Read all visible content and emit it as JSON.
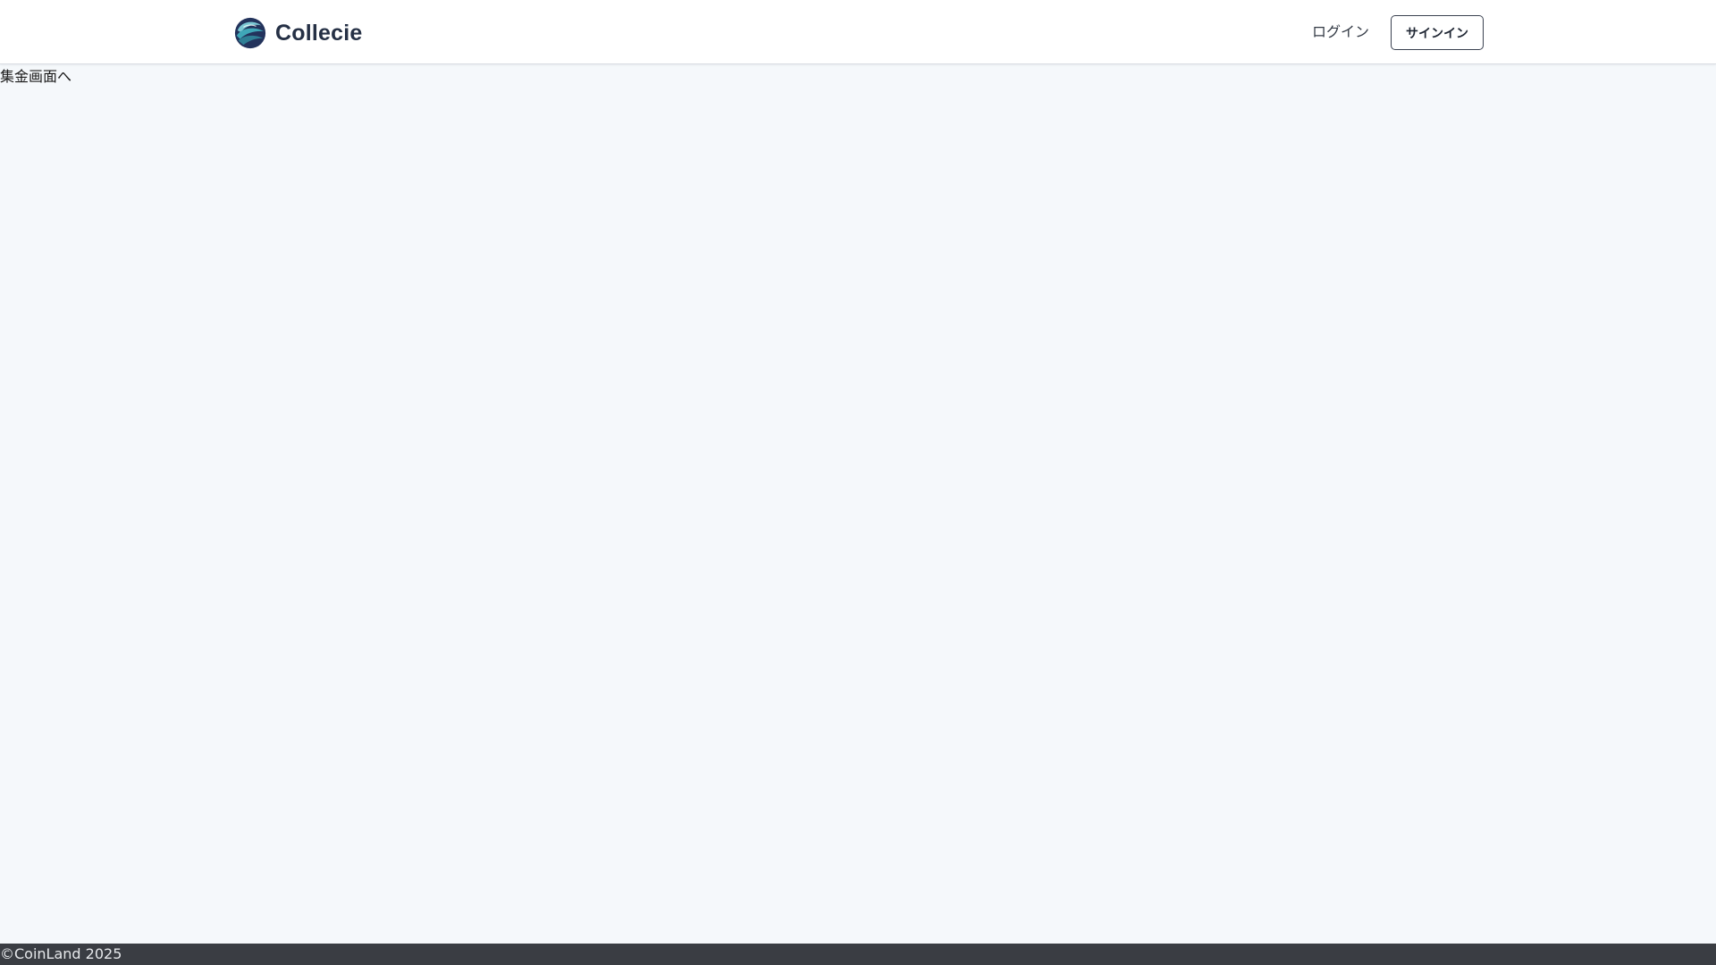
{
  "header": {
    "brand_name": "Collecie",
    "logo_icon": "collecie-swirl-logo-icon",
    "nav": {
      "login_label": "ログイン",
      "signin_label": "サインイン"
    }
  },
  "main": {
    "collect_link_label": "集金画面へ"
  },
  "footer": {
    "copyright": "©CoinLand 2025"
  },
  "colors": {
    "page_background": "#f5f8fb",
    "header_background": "#ffffff",
    "brand_text": "#253045",
    "footer_background": "#3a3d43",
    "logo_teal": "#3fa7b8",
    "logo_navy": "#23335c"
  }
}
